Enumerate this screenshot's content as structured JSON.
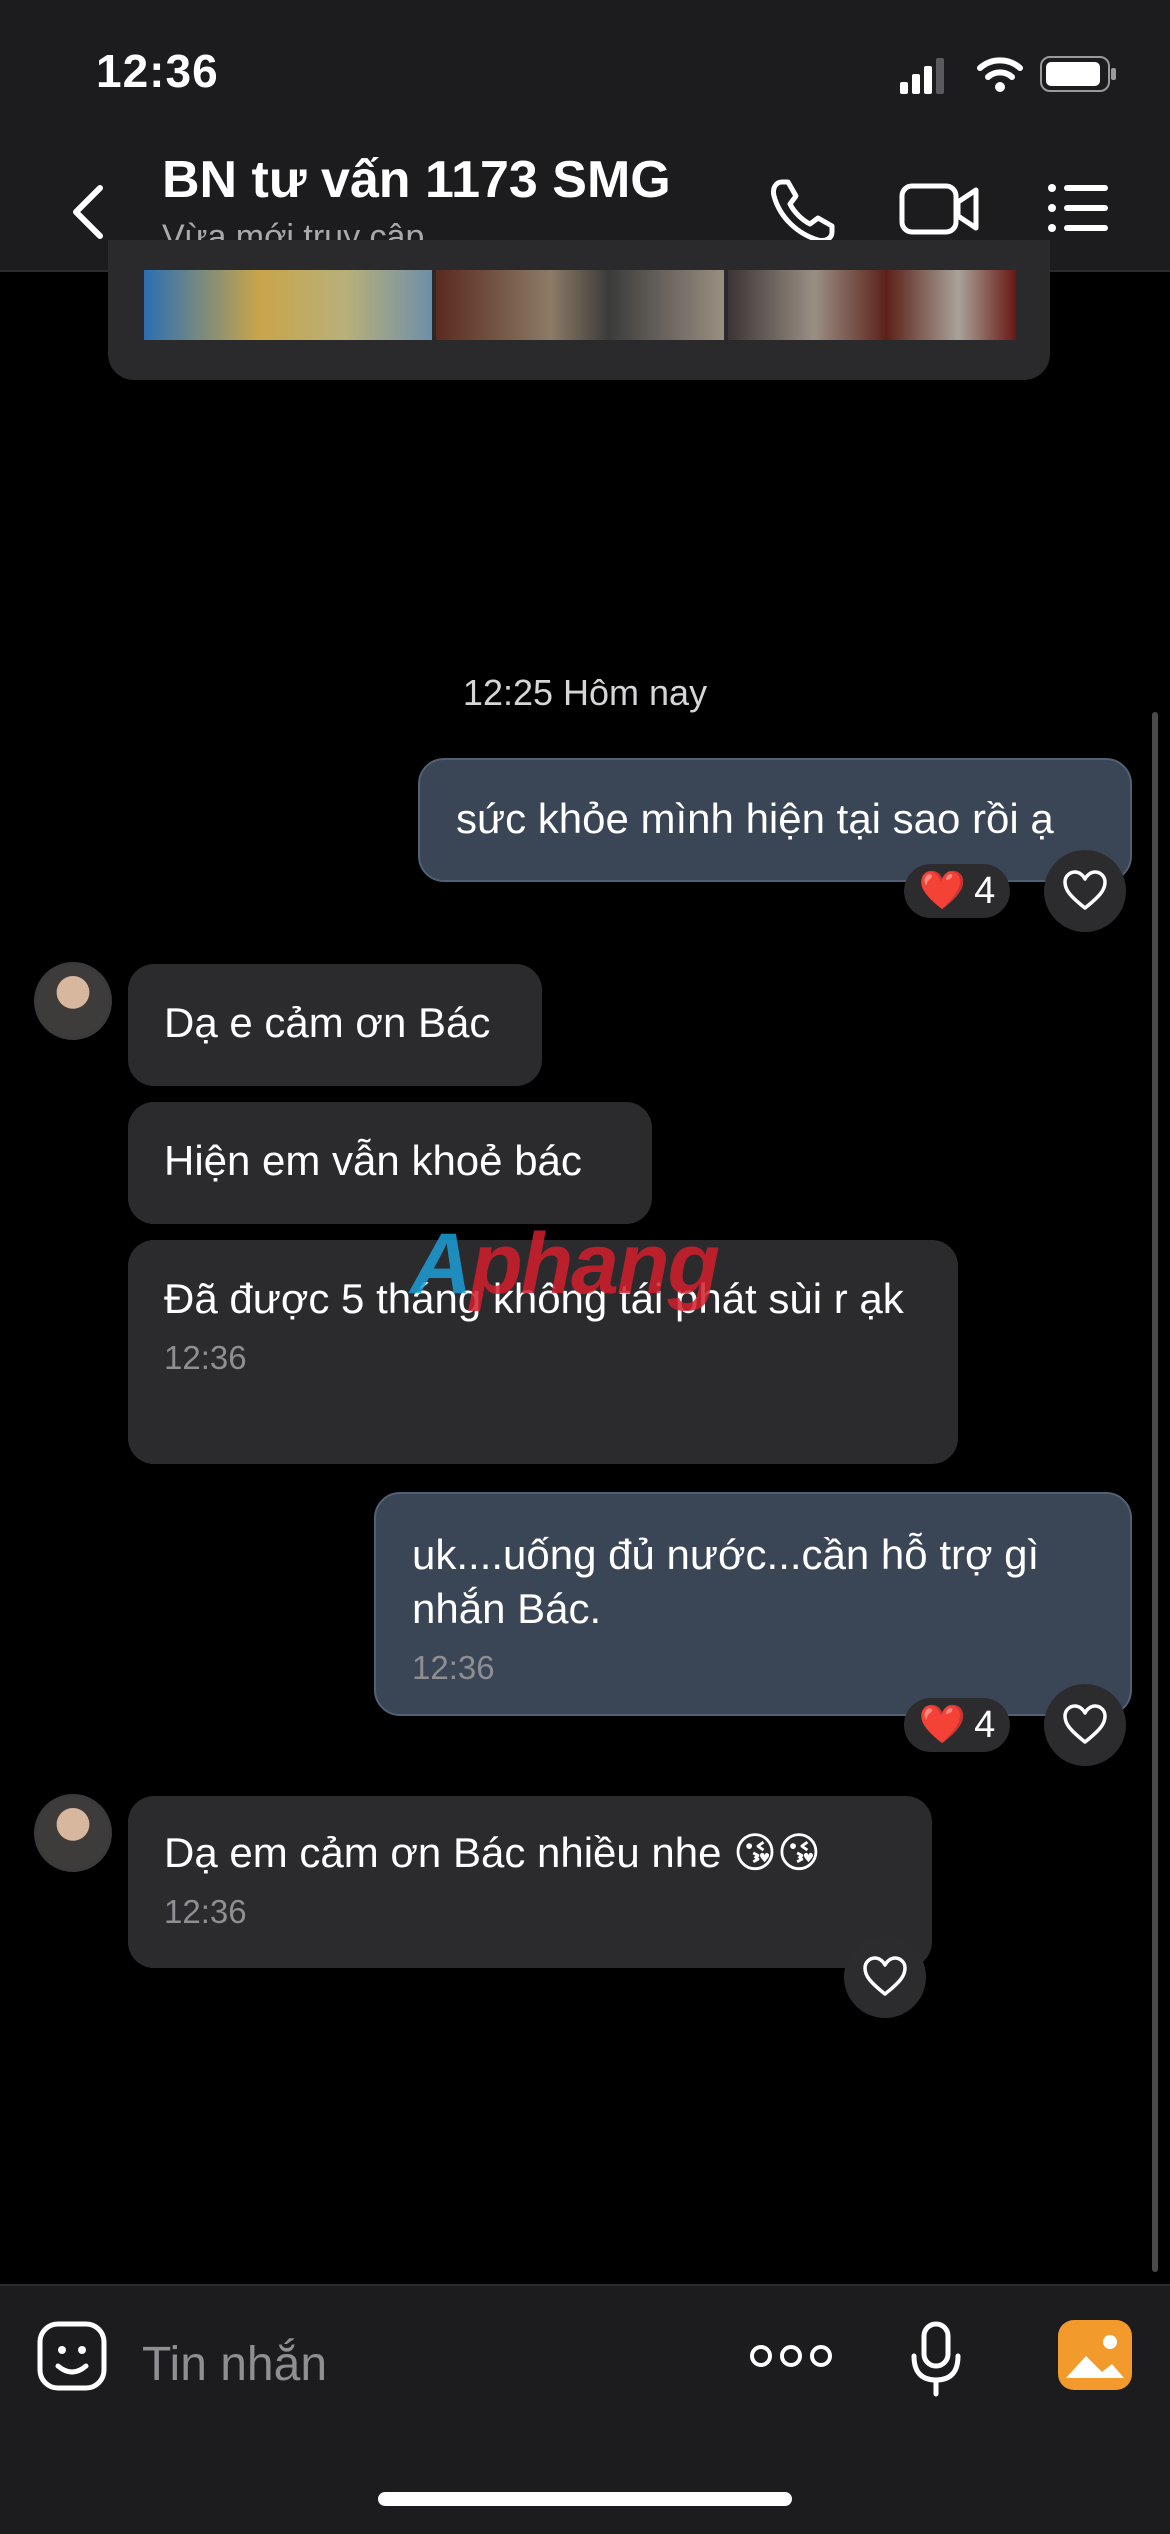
{
  "status_bar": {
    "time": "12:36"
  },
  "header": {
    "title": "BN tư vấn 1173 SMG",
    "subtitle": "Vừa mới truy cập",
    "icons": [
      "back-icon",
      "phone-icon",
      "video-icon",
      "menu-icon"
    ]
  },
  "timestamp_divider": "12:25 Hôm nay",
  "messages": [
    {
      "direction": "outgoing",
      "text": "sức khỏe mình hiện tại sao rồi ạ",
      "reaction": "❤️",
      "reaction_count": "4"
    },
    {
      "direction": "incoming",
      "text": "Dạ e cảm ơn Bác"
    },
    {
      "direction": "incoming",
      "text": "Hiện em vẫn khoẻ bác"
    },
    {
      "direction": "incoming",
      "text": "Đã được 5 tháng không tái phát sùi r ạk",
      "time": "12:36"
    },
    {
      "direction": "outgoing",
      "text": "uk....uống đủ nước...cần hỗ trợ gì nhắn Bác.",
      "time": "12:36",
      "reaction": "❤️",
      "reaction_count": "4"
    },
    {
      "direction": "incoming",
      "text": "Dạ em cảm ơn Bác nhiều nhe 😘😘",
      "time": "12:36"
    }
  ],
  "watermark": {
    "part1": "A",
    "part2": "phang"
  },
  "composer": {
    "placeholder": "Tin nhắn"
  },
  "colors": {
    "outgoing_bubble": "#3a4556",
    "incoming_bubble": "#2b2b2e",
    "accent_orange": "#f39a2c"
  }
}
